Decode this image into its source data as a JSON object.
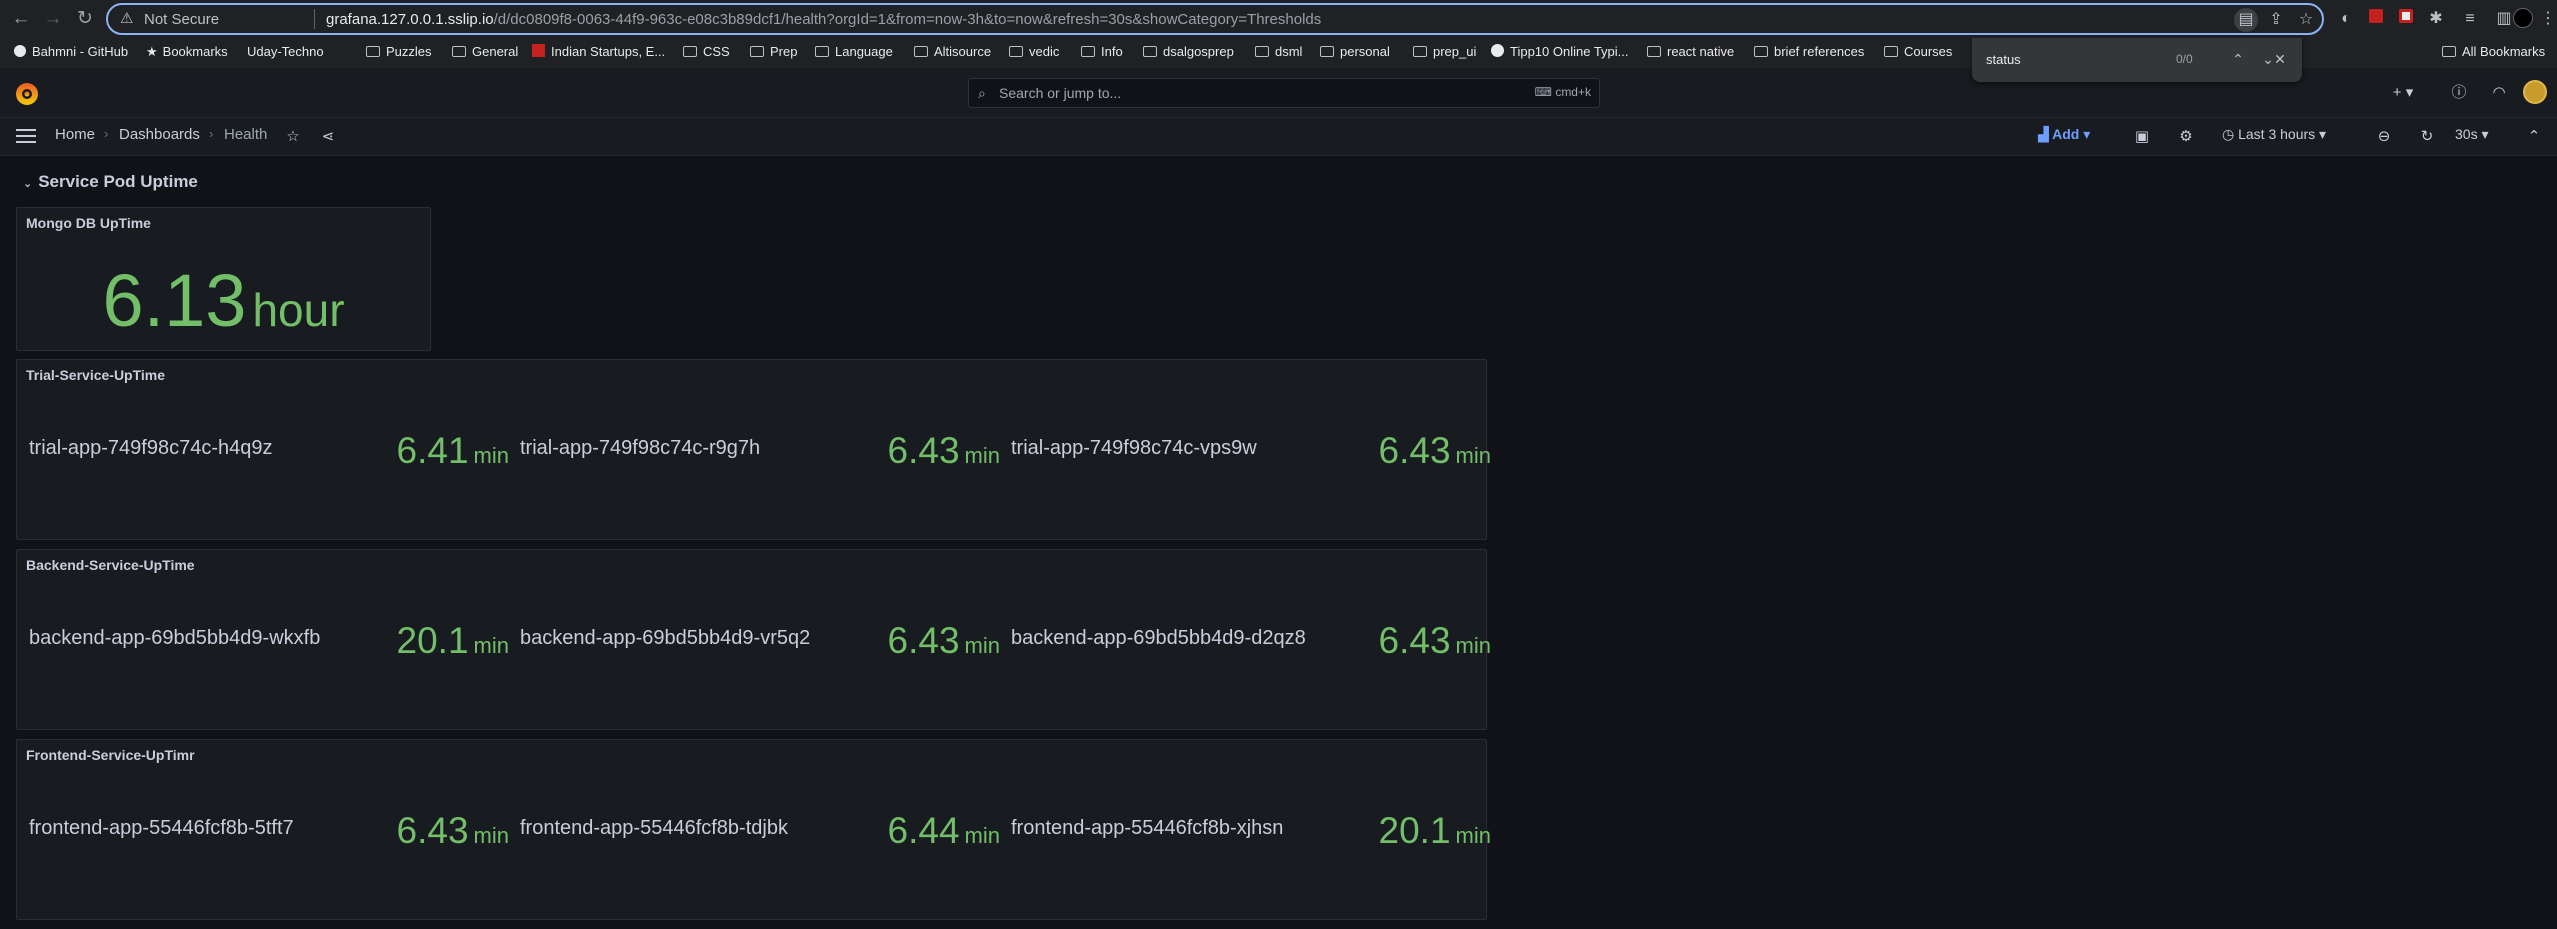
{
  "browser": {
    "security_label": "Not Secure",
    "url_host": "grafana.127.0.0.1.sslip.io",
    "url_path": "/d/dc0809f8-0063-44f9-963c-e08c3b89dcf1/health?orgId=1&from=now-3h&to=now&refresh=30s&showCategory=Thresholds",
    "bookmarks": [
      "Bahmni - GitHub",
      "Bookmarks",
      "Uday-Techno",
      "Puzzles",
      "General",
      "Indian Startups, E...",
      "CSS",
      "Prep",
      "Language",
      "Altisource",
      "vedic",
      "Info",
      "dsalgosprep",
      "dsml",
      "personal",
      "prep_ui",
      "Tipp10 Online Typi...",
      "react native",
      "brief references",
      "Courses"
    ],
    "all_bookmarks": "All Bookmarks",
    "find": {
      "query": "status",
      "count": "0/0"
    }
  },
  "grafana": {
    "search_placeholder": "Search or jump to...",
    "search_shortcut": "cmd+k",
    "breadcrumbs": [
      "Home",
      "Dashboards",
      "Health"
    ],
    "add_label": "Add",
    "time_range": "Last 3 hours",
    "refresh_interval": "30s"
  },
  "dashboard": {
    "row_title": "Service Pod Uptime",
    "mongo_panel": {
      "title": "Mongo DB UpTime",
      "value": "6.13",
      "unit": "hour"
    },
    "panels": [
      {
        "title": "Trial-Service-UpTime",
        "stats": [
          {
            "name": "trial-app-749f98c74c-h4q9z",
            "value": "6.41",
            "unit": "min"
          },
          {
            "name": "trial-app-749f98c74c-r9g7h",
            "value": "6.43",
            "unit": "min"
          },
          {
            "name": "trial-app-749f98c74c-vps9w",
            "value": "6.43",
            "unit": "min"
          }
        ]
      },
      {
        "title": "Backend-Service-UpTime",
        "stats": [
          {
            "name": "backend-app-69bd5bb4d9-wkxfb",
            "value": "20.1",
            "unit": "min"
          },
          {
            "name": "backend-app-69bd5bb4d9-vr5q2",
            "value": "6.43",
            "unit": "min"
          },
          {
            "name": "backend-app-69bd5bb4d9-d2qz8",
            "value": "6.43",
            "unit": "min"
          }
        ]
      },
      {
        "title": "Frontend-Service-UpTimr",
        "stats": [
          {
            "name": "frontend-app-55446fcf8b-5tft7",
            "value": "6.43",
            "unit": "min"
          },
          {
            "name": "frontend-app-55446fcf8b-tdjbk",
            "value": "6.44",
            "unit": "min"
          },
          {
            "name": "frontend-app-55446fcf8b-xjhsn",
            "value": "20.1",
            "unit": "min"
          }
        ]
      }
    ]
  },
  "colors": {
    "stat_green": "#73bf69",
    "background": "#111217",
    "panel_bg": "#181b1f",
    "accent_blue": "#6e9fff"
  }
}
